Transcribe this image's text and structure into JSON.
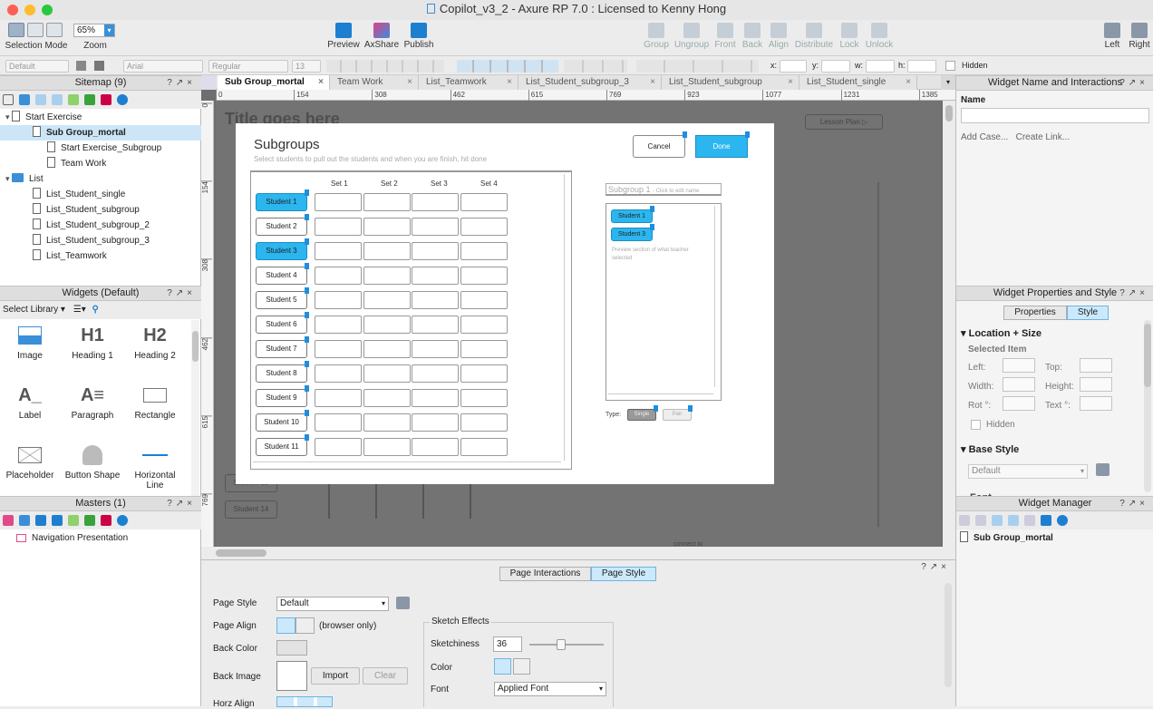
{
  "window": {
    "title": "Copilot_v3_2 - Axure RP 7.0 : Licensed to Kenny Hong"
  },
  "toolbar": {
    "selection_mode": "Selection Mode",
    "zoom_label": "Zoom",
    "zoom_value": "65%",
    "preview": "Preview",
    "axshare": "AxShare",
    "publish": "Publish",
    "group": "Group",
    "ungroup": "Ungroup",
    "front": "Front",
    "back": "Back",
    "align": "Align",
    "distribute": "Distribute",
    "lock": "Lock",
    "unlock": "Unlock",
    "left": "Left",
    "right": "Right"
  },
  "format": {
    "style": "Default",
    "font": "Arial",
    "weight": "Regular",
    "size": "13",
    "x": "x:",
    "y": "y:",
    "w": "w:",
    "h": "h:",
    "hidden": "Hidden"
  },
  "sitemap": {
    "title": "Sitemap (9)",
    "items": [
      {
        "label": "Start Exercise",
        "level": 0,
        "type": "page"
      },
      {
        "label": "Sub Group_mortal",
        "level": 1,
        "type": "page"
      },
      {
        "label": "Start Exercise_Subgroup",
        "level": 2,
        "type": "page"
      },
      {
        "label": "Team Work",
        "level": 2,
        "type": "page"
      },
      {
        "label": "List",
        "level": 0,
        "type": "folder"
      },
      {
        "label": "List_Student_single",
        "level": 1,
        "type": "page"
      },
      {
        "label": "List_Student_subgroup",
        "level": 1,
        "type": "page"
      },
      {
        "label": "List_Student_subgroup_2",
        "level": 1,
        "type": "page"
      },
      {
        "label": "List_Student_subgroup_3",
        "level": 1,
        "type": "page"
      },
      {
        "label": "List_Teamwork",
        "level": 1,
        "type": "page"
      }
    ]
  },
  "widgets": {
    "title": "Widgets (Default)",
    "select_library": "Select Library",
    "items": [
      {
        "label": "Image",
        "glyph": ""
      },
      {
        "label": "Heading 1",
        "glyph": "H1"
      },
      {
        "label": "Heading 2",
        "glyph": "H2"
      },
      {
        "label": "Label",
        "glyph": "A_"
      },
      {
        "label": "Paragraph",
        "glyph": "A≡"
      },
      {
        "label": "Rectangle",
        "glyph": ""
      },
      {
        "label": "Placeholder",
        "glyph": ""
      },
      {
        "label": "Button Shape",
        "glyph": ""
      },
      {
        "label": "Horizontal Line",
        "glyph": ""
      }
    ]
  },
  "masters": {
    "title": "Masters (1)",
    "items": [
      "Navigation Presentation"
    ]
  },
  "tabs": [
    "Sub Group_mortal",
    "Team Work",
    "List_Teamwork",
    "List_Student_subgroup_3",
    "List_Student_subgroup",
    "List_Student_single"
  ],
  "ruler": {
    "h": [
      "0",
      "154",
      "308",
      "462",
      "615",
      "769",
      "923",
      "1077",
      "1231",
      "1385"
    ],
    "v": [
      "0",
      "154",
      "308",
      "462",
      "615",
      "769"
    ]
  },
  "canvas": {
    "bg_title": "Title goes here",
    "lesson_plan": "Lesson Plan",
    "bg_students": [
      "Student 13",
      "Student 14"
    ],
    "connect": "connect to"
  },
  "modal": {
    "title": "Subgroups",
    "subtitle": "Select students to pull out the students and when you are finish, hit done",
    "cancel": "Cancel",
    "done": "Done",
    "sets": [
      "Set 1",
      "Set 2",
      "Set 3",
      "Set 4"
    ],
    "students": [
      "Student 1",
      "Student 2",
      "Student 3",
      "Student 4",
      "Student 5",
      "Student 6",
      "Student 7",
      "Student 8",
      "Student 9",
      "Student 10",
      "Student 11"
    ],
    "selected": [
      "Student 1",
      "Student 3"
    ],
    "subgroup_name": "Subgroup 1",
    "subgroup_hint": "- Click to edit name",
    "preview_students": [
      "Student 1",
      "Student 3"
    ],
    "preview_text": "Preview section of what teacher selected",
    "type_label": "Type:",
    "type_single": "Single",
    "type_pair": "Pair"
  },
  "pagestyle": {
    "tab_interactions": "Page Interactions",
    "tab_style": "Page Style",
    "page_style_label": "Page Style",
    "page_style_value": "Default",
    "page_align_label": "Page Align",
    "browser_only": "(browser only)",
    "back_color_label": "Back Color",
    "back_image_label": "Back Image",
    "import": "Import",
    "clear": "Clear",
    "horz_align_label": "Horz Align",
    "sketch_title": "Sketch Effects",
    "sketchiness_label": "Sketchiness",
    "sketchiness_value": "36",
    "sketchiness_fraction": 0.36,
    "color_label": "Color",
    "font_label": "Font",
    "font_value": "Applied Font"
  },
  "right": {
    "name_panel_title": "Widget Name and Interactions",
    "name_label": "Name",
    "add_case": "Add Case...",
    "create_link": "Create Link...",
    "props_title": "Widget Properties and Style",
    "tab_properties": "Properties",
    "tab_style": "Style",
    "loc_size": "Location + Size",
    "selected_item": "Selected Item",
    "left": "Left:",
    "top": "Top:",
    "width": "Width:",
    "height": "Height:",
    "rot": "Rot °:",
    "text": "Text °:",
    "hidden": "Hidden",
    "base_style": "Base Style",
    "base_style_value": "Default",
    "font_cut": "Font",
    "manager_title": "Widget Manager",
    "manager_items": [
      "Sub Group_mortal"
    ]
  },
  "colors": {
    "accent": "#2bb6ef",
    "selection": "#cde6f7"
  }
}
